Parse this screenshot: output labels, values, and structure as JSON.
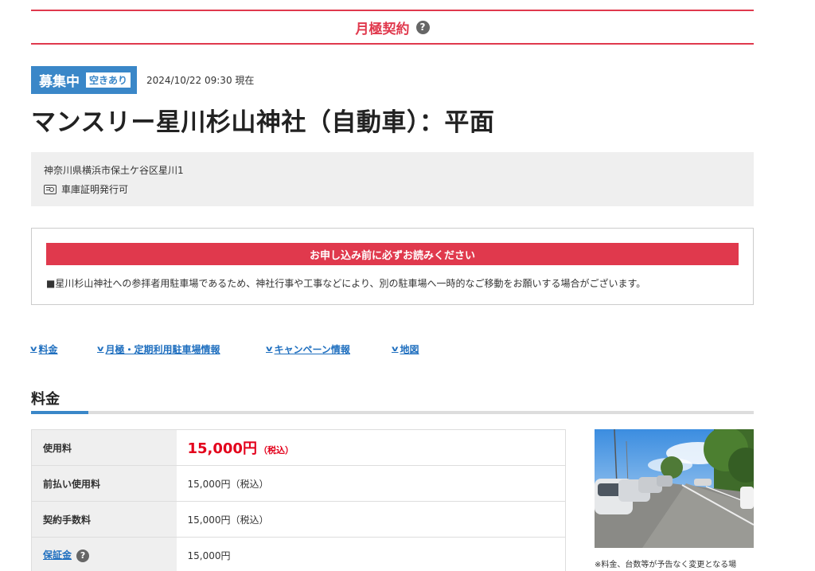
{
  "header": {
    "title": "月極契約",
    "help_icon": "question-circle-icon"
  },
  "status": {
    "badge": "募集中",
    "vacancy": "空きあり",
    "timestamp": "2024/10/22 09:30 現在"
  },
  "page_title": "マンスリー星川杉山神社（自動車）：平面",
  "address": {
    "text": "神奈川県横浜市保土ケ谷区星川1",
    "certificate": "車庫証明発行可",
    "certificate_icon": "certificate-card-icon"
  },
  "notice": {
    "heading": "お申し込み前に必ずお読みください",
    "text": "■星川杉山神社への参拝者用駐車場であるため、神社行事や工事などにより、別の駐車場へ一時的なご移動をお願いする場合がございます。"
  },
  "anchor_nav": [
    {
      "label": "料金"
    },
    {
      "label": "月極・定期利用駐車場情報"
    },
    {
      "label": "キャンペーン情報"
    },
    {
      "label": "地図"
    }
  ],
  "section": {
    "title": "料金"
  },
  "fees": [
    {
      "label": "使用料",
      "amount": "15,000円",
      "tax": "（税込）"
    },
    {
      "label": "前払い使用料",
      "value": "15,000円（税込）"
    },
    {
      "label": "契約手数料",
      "value": "15,000円（税込）"
    },
    {
      "label": "保証金",
      "value": "15,000円"
    }
  ],
  "photo_note": "※料金、台数等が予告なく変更となる場",
  "colors": {
    "accent_red": "#e0394d",
    "accent_blue": "#3a87c8",
    "link": "#1f6fbf",
    "price": "#e3001b"
  }
}
